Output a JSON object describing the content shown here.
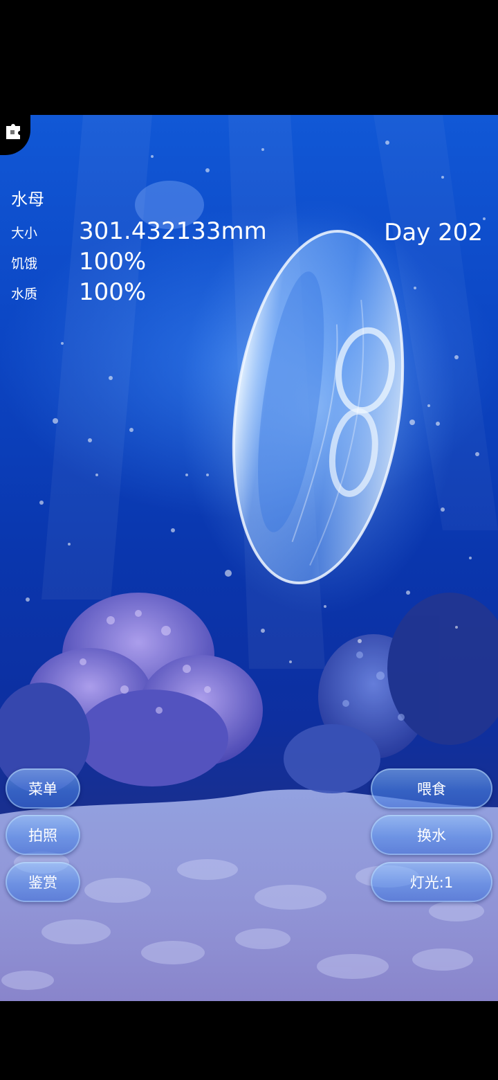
{
  "stats": {
    "title": "水母",
    "size_label": "大小",
    "size_value": "301.432133mm",
    "hunger_label": "饥饿",
    "hunger_value": "100%",
    "water_label": "水质",
    "water_value": "100%",
    "day": "Day 202"
  },
  "left_buttons": {
    "menu": "菜单",
    "photo": "拍照",
    "appreciate": "鉴赏"
  },
  "right_buttons": {
    "feed": "喂食",
    "change_water": "换水",
    "light": "灯光:1"
  },
  "icons": {
    "corner": "puzzle-icon"
  },
  "colors": {
    "water_top": "#1158d6",
    "water_bottom": "#6d66b8",
    "button_tint": "#6fa6ff"
  }
}
